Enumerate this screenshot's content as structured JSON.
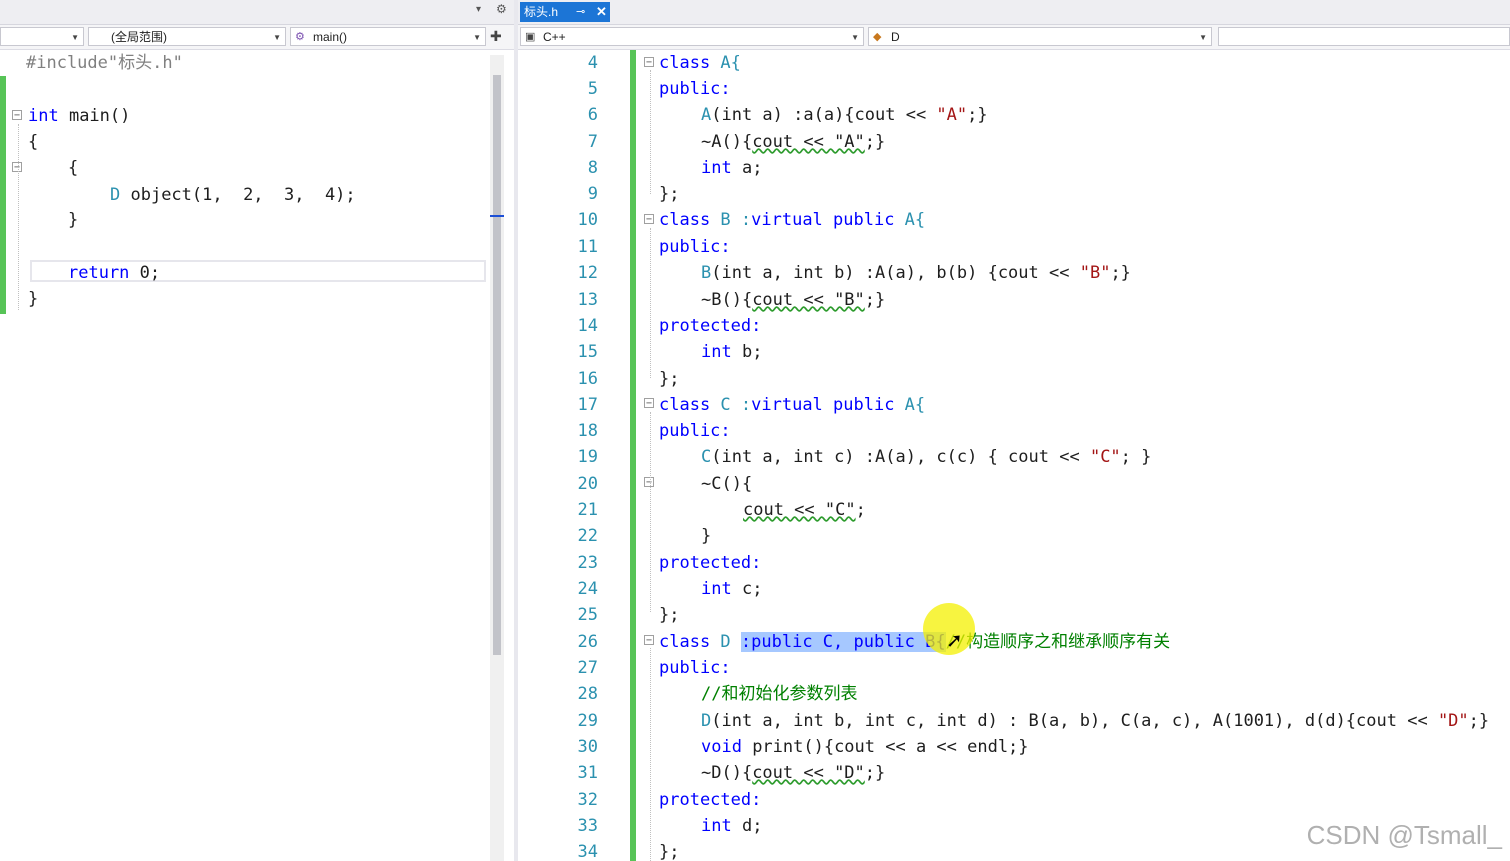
{
  "left": {
    "toolbar": {
      "dropdown_arrow": "▾",
      "gear_icon": "⚙"
    },
    "nav": {
      "scope_combo": "",
      "global_scope": "(全局范围)",
      "function_combo": "main()",
      "split_icon": "✚"
    },
    "code": {
      "line1": "#include\"标头.h\"",
      "line3_kw": "int",
      "line3_rest": " main()",
      "line4": "{",
      "line6": "{",
      "line7_type": "D",
      "line7_rest": " object(1,  2,  3,  4);",
      "line8": "}",
      "line10_kw": "return",
      "line10_rest": " 0;",
      "line11": "}"
    }
  },
  "right": {
    "tab": {
      "label": "标头.h",
      "pin": "⊸",
      "close": "✕"
    },
    "nav": {
      "language": "C++",
      "symbol": "D"
    },
    "line_numbers": [
      "4",
      "5",
      "6",
      "7",
      "8",
      "9",
      "10",
      "11",
      "12",
      "13",
      "14",
      "15",
      "16",
      "17",
      "18",
      "19",
      "20",
      "21",
      "22",
      "23",
      "24",
      "25",
      "26",
      "27",
      "28",
      "29",
      "30",
      "31",
      "32",
      "33",
      "34"
    ],
    "code": {
      "l4_kw": "class",
      "l4_t": " A{",
      "l5": "public:",
      "l6_a": "A",
      "l6_b": "(int a) :a(a){cout << ",
      "l6_s": "\"A\"",
      "l6_c": ";}",
      "l7_a": "~A(){",
      "l7_sq": "cout << \"A\"",
      "l7_c": ";}",
      "l8_kw": "int",
      "l8_rest": " a;",
      "l9": "};",
      "l10_kw": "class",
      "l10_a": " B :",
      "l10_kw2": "virtual public",
      "l10_b": " A{",
      "l11": "public:",
      "l12_a": "B",
      "l12_b": "(int a, int b) :A(a), b(b) {cout << ",
      "l12_s": "\"B\"",
      "l12_c": ";}",
      "l13_a": "~B(){",
      "l13_sq": "cout << \"B\"",
      "l13_c": ";}",
      "l14": "protected:",
      "l15_kw": "int",
      "l15_rest": " b;",
      "l16": "};",
      "l17_kw": "class",
      "l17_a": " C :",
      "l17_kw2": "virtual public",
      "l17_b": " A{",
      "l18": "public:",
      "l19_a": "C",
      "l19_b": "(int a, int c) :A(a), c(c) { cout << ",
      "l19_s": "\"C\"",
      "l19_c": "; }",
      "l20": "~C(){",
      "l21_sq": "cout << \"C\"",
      "l21_c": ";",
      "l22": "}",
      "l23": "protected:",
      "l24_kw": "int",
      "l24_rest": " c;",
      "l25": "};",
      "l26_kw": "class",
      "l26_a": " D ",
      "l26_sel": ":public C, public B{",
      "l26_cm": "//构造顺序之和继承顺序有关",
      "l27": "public:",
      "l28_cm": "//和初始化参数列表",
      "l29_a": "D",
      "l29_b": "(int a, int b, int c, int d) : B(a, b), C(a, c), A(1001), d(d){cout << ",
      "l29_s": "\"D\"",
      "l29_c": ";}",
      "l30_kw": "void",
      "l30_rest": " print(){cout << a << endl;}",
      "l31_a": "~D(){",
      "l31_sq": "cout << \"D\"",
      "l31_c": ";}",
      "l32": "protected:",
      "l33_kw": "int",
      "l33_rest": " d;",
      "l34": "};"
    }
  },
  "watermark": "CSDN @Tsmall_"
}
